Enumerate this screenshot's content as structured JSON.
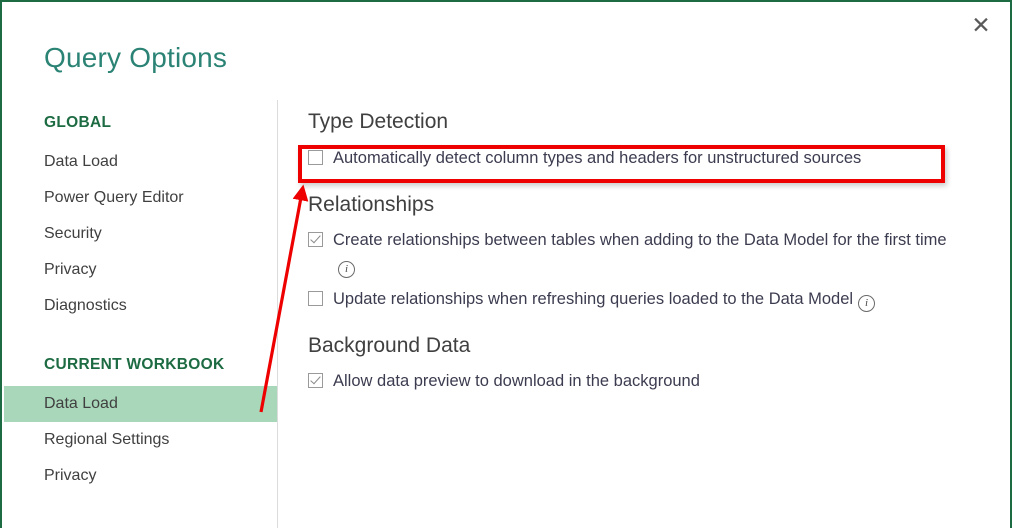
{
  "window": {
    "title": "Query Options",
    "close_label": "✕",
    "accent_border": "#1d6b42",
    "title_color": "#2a8374"
  },
  "sidebar": {
    "groups": [
      {
        "heading": "GLOBAL",
        "items": [
          {
            "label": "Data Load",
            "selected": false
          },
          {
            "label": "Power Query Editor",
            "selected": false
          },
          {
            "label": "Security",
            "selected": false
          },
          {
            "label": "Privacy",
            "selected": false
          },
          {
            "label": "Diagnostics",
            "selected": false
          }
        ]
      },
      {
        "heading": "CURRENT WORKBOOK",
        "items": [
          {
            "label": "Data Load",
            "selected": true
          },
          {
            "label": "Regional Settings",
            "selected": false
          },
          {
            "label": "Privacy",
            "selected": false
          }
        ]
      }
    ],
    "selected_highlight_color": "#a9d7ba",
    "heading_color": "#1d6b42"
  },
  "main": {
    "sections": [
      {
        "heading": "Type Detection",
        "options": [
          {
            "label": "Automatically detect column types and headers for unstructured sources",
            "checked": false,
            "info": false
          }
        ]
      },
      {
        "heading": "Relationships",
        "options": [
          {
            "label": "Create relationships between tables when adding to the Data Model for the first time",
            "checked": true,
            "info": true
          },
          {
            "label": "Update relationships when refreshing queries loaded to the Data Model",
            "checked": false,
            "info": true
          }
        ]
      },
      {
        "heading": "Background Data",
        "options": [
          {
            "label": "Allow data preview to download in the background",
            "checked": true,
            "info": false
          }
        ]
      }
    ],
    "info_glyph": "i"
  },
  "annotation": {
    "color": "#ee0000",
    "highlight_target": "Automatically detect column types and headers for unstructured sources",
    "arrow_from": "Data Load (Current Workbook)",
    "arrow_to": "Type Detection checkbox"
  }
}
